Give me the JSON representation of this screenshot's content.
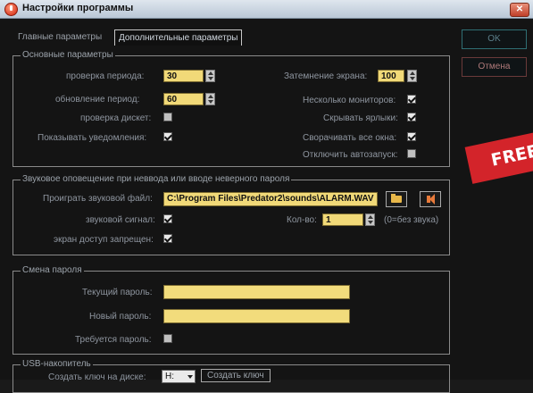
{
  "window": {
    "title": "Настройки программы",
    "close_glyph": "✕"
  },
  "tabs": [
    {
      "label": "Главные параметры"
    },
    {
      "label": "Дополнительные параметры"
    }
  ],
  "buttons": {
    "ok": "OK",
    "cancel": "Отмена"
  },
  "main_group": {
    "title": "Основные параметры",
    "check_period_label": "проверка периода:",
    "check_period_value": "30",
    "update_period_label": "обновление период:",
    "update_period_value": "60",
    "disk_check_label": "проверка дискет:",
    "notify_label": "Показывать уведомления:",
    "dimming_label": "Затемнение экрана:",
    "dimming_value": "100",
    "monitors_label": "Несколько мониторов:",
    "hide_shortcuts_label": "Скрывать ярлыки:",
    "minimize_label": "Сворачивать все окна:",
    "autorun_label": "Отключить автозапуск:"
  },
  "sound_group": {
    "title": "Звуковое оповещение при неввода или вводе неверного пароля",
    "play_label": "Проиграть звуковой файл:",
    "file_path": "C:\\Program Files\\Predator2\\sounds\\ALARM.WAV",
    "beep_label": "звуковой сигнал:",
    "count_label": "Кол-во:",
    "count_value": "1",
    "count_hint": "(0=без звука)",
    "access_denied_label": "экран доступ запрещен:"
  },
  "password_group": {
    "title": "Смена пароля",
    "current_label": "Текущий пароль:",
    "new_label": "Новый пароль:",
    "required_label": "Требуется пароль:"
  },
  "usb_group": {
    "title": "USB-накопитель",
    "create_key_label": "Создать ключ на диске:",
    "drive_value": "H:",
    "create_key_button": "Создать ключ"
  },
  "banner": {
    "text": "FREE"
  }
}
